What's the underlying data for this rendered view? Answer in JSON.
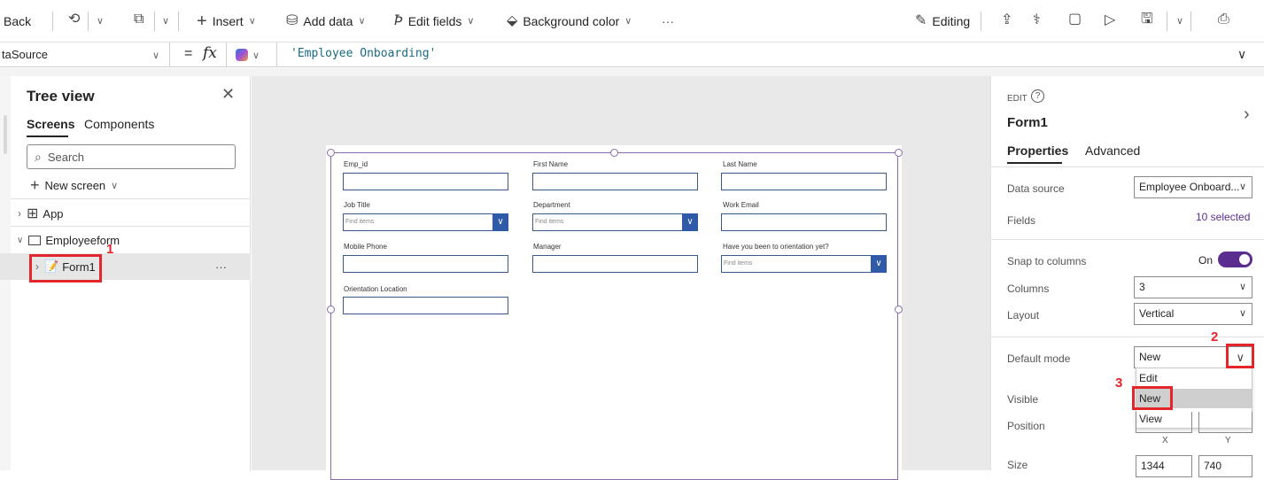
{
  "toolbar": {
    "back": "Back",
    "insert": "Insert",
    "add_data": "Add data",
    "edit_fields": "Edit fields",
    "background_color": "Background color",
    "more": "···",
    "editing": "Editing"
  },
  "formula_bar": {
    "property": "taSource",
    "fx": "fx",
    "equals": "=",
    "formula": "'Employee Onboarding'"
  },
  "tree_view": {
    "title": "Tree view",
    "tabs": [
      "Screens",
      "Components"
    ],
    "search_placeholder": "Search",
    "new_screen": "New screen",
    "items": {
      "app": "App",
      "screen": "Employeeform",
      "form": "Form1"
    },
    "more": "···"
  },
  "form": {
    "fields": [
      {
        "label": "Emp_id",
        "type": "text"
      },
      {
        "label": "First Name",
        "type": "text"
      },
      {
        "label": "Last Name",
        "type": "text"
      },
      {
        "label": "Job Title",
        "type": "dropdown",
        "placeholder": "Find items"
      },
      {
        "label": "Department",
        "type": "dropdown",
        "placeholder": "Find items"
      },
      {
        "label": "Work Email",
        "type": "text"
      },
      {
        "label": "Mobile Phone",
        "type": "text"
      },
      {
        "label": "Manager",
        "type": "text"
      },
      {
        "label": "Have you been to orientation yet?",
        "type": "dropdown",
        "placeholder": "Find items"
      },
      {
        "label": "Orientation Location",
        "type": "text"
      }
    ]
  },
  "properties": {
    "edit_label": "EDIT",
    "title": "Form1",
    "tabs": [
      "Properties",
      "Advanced"
    ],
    "data_source_label": "Data source",
    "data_source_value": "Employee Onboard...",
    "fields_label": "Fields",
    "fields_value": "10 selected",
    "snap_label": "Snap to columns",
    "snap_value": "On",
    "columns_label": "Columns",
    "columns_value": "3",
    "layout_label": "Layout",
    "layout_value": "Vertical",
    "default_mode_label": "Default mode",
    "default_mode_value": "New",
    "default_mode_options": [
      "Edit",
      "New",
      "View"
    ],
    "visible_label": "Visible",
    "position_label": "Position",
    "position_x_label": "X",
    "position_y_label": "Y",
    "size_label": "Size",
    "size_width": "1344",
    "size_height": "740"
  },
  "annotations": [
    "1",
    "2",
    "3"
  ],
  "colors": {
    "accent": "#5c2d91",
    "annotation": "#e3262b",
    "form_border": "#8a6ba8",
    "dropdown_button": "#2e5aa8"
  }
}
